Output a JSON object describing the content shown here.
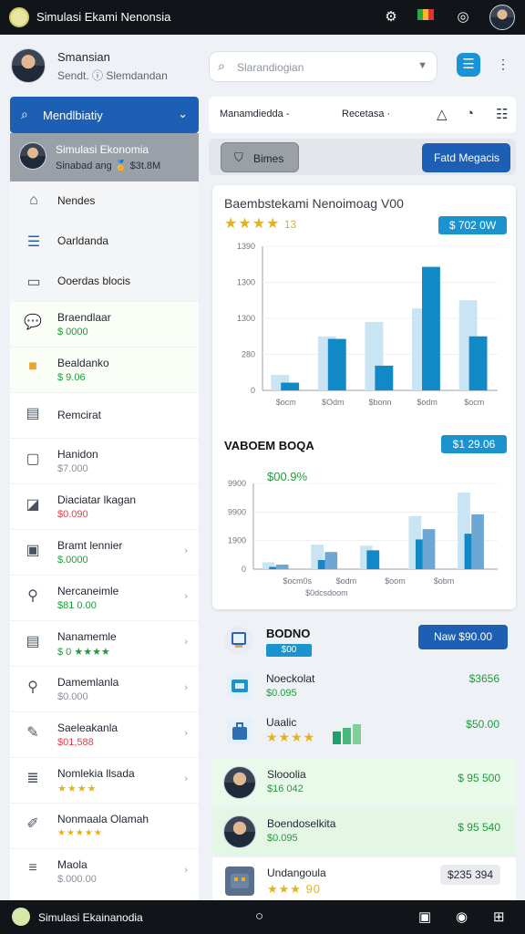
{
  "app": {
    "title": "Simulasi Ekami Nenonsia",
    "icons": [
      "settings-icon",
      "flag-icon",
      "chat-icon"
    ]
  },
  "profile": {
    "name": "Smansian",
    "subtitle": "Sendt. ⓘ Slemdandan"
  },
  "search": {
    "placeholder": "Slarandiogian"
  },
  "sidebar": {
    "header": "Mendlbiatiy",
    "active": {
      "title": "Simulasi Ekonomia",
      "subtitle": "Sinabad ang 🏅 $3t.8M"
    },
    "nav": [
      {
        "label": "Nendes",
        "icon": "home-icon"
      },
      {
        "label": "Oarldanda",
        "icon": "list-icon"
      },
      {
        "label": "Ooerdas blocis",
        "icon": "folder-icon"
      }
    ],
    "rows": [
      {
        "label": "Braendlaar",
        "value": "$ 0000",
        "tone": "green",
        "icon": "chat-bubble-icon"
      },
      {
        "label": "Bealdanko",
        "value": "$ 9.06",
        "tone": "green",
        "icon": "briefcase-icon"
      },
      {
        "label": "Remcirat",
        "value": "",
        "tone": "gray",
        "icon": "box-icon"
      },
      {
        "label": "Hanidon",
        "value": "$7.000",
        "tone": "gray",
        "icon": "document-icon"
      },
      {
        "label": "Diaciatar lkagan",
        "value": "$0.090",
        "tone": "red",
        "icon": "tag-icon"
      },
      {
        "label": "Bramt lennier",
        "value": "$.0000",
        "tone": "green",
        "icon": "clipboard-icon"
      },
      {
        "label": "Nercaneimle",
        "value": "$81 0.00",
        "tone": "green",
        "icon": "wrench-icon"
      },
      {
        "label": "Nanamemle",
        "value": "$ 0 ★★★★",
        "tone": "green",
        "icon": "calendar-icon"
      },
      {
        "label": "Damemlanla",
        "value": "$0.000",
        "tone": "gray",
        "icon": "search-icon"
      },
      {
        "label": "Saeleakanla",
        "value": "$01,588",
        "tone": "red",
        "icon": "pen-icon"
      },
      {
        "label": "Nomlekia llsada",
        "value": "★★★★",
        "tone": "stars",
        "icon": "layers-icon"
      },
      {
        "label": "Nonmaala Olamah",
        "value": "★★★★★",
        "tone": "stars",
        "icon": "pencil-icon"
      },
      {
        "label": "Maola",
        "value": "$.000.00",
        "tone": "gray",
        "icon": "menu-icon"
      }
    ]
  },
  "toolbar": {
    "label1": "Manamdiedda ‑",
    "label2": "Recetasa ·"
  },
  "tabs": {
    "active": "Bimes",
    "button": "Fatd Megacis"
  },
  "chart1": {
    "title": "Baembstekami Nenoimoag V00",
    "stars": "★★★★",
    "star_note": "13",
    "badge": "$ 702 0W"
  },
  "chart2": {
    "title": "VABOEM BOQA",
    "badge": "$1 29.06",
    "percent": "$00.9%"
  },
  "low": {
    "title": "BODNO",
    "badge": "$00",
    "button": "Naw $90.00",
    "rows": [
      {
        "label": "Noeckolat",
        "value": "$0.095",
        "right": "$3656",
        "tone": "green"
      },
      {
        "label": "Uaalic",
        "value": "★★★★",
        "right": "$50.00",
        "tone": "stars"
      }
    ]
  },
  "people": [
    {
      "label": "Slooolia",
      "value": "$16 042",
      "right": "$ 95 500",
      "tone": "green"
    },
    {
      "label": "Boendoselkita",
      "value": "$0.095",
      "right": "$ 95 540",
      "tone": "green"
    },
    {
      "label": "Undangoula",
      "value": "★★★ 90",
      "right": "$235 394",
      "tone": "stars"
    }
  ],
  "navbar": {
    "label": "Simulasi Ekainanodia"
  },
  "chart_data": [
    {
      "type": "bar",
      "title": "Baembstekami Nenoimoag V00",
      "categories": [
        "$ocm",
        "$Odm",
        "$bonn",
        "$odm",
        "$ocm"
      ],
      "series": [
        {
          "name": "",
          "values": [
            300,
            1050,
            1330,
            1590,
            1750
          ],
          "color": "#c9e4f3"
        },
        {
          "name": "",
          "values": [
            150,
            1000,
            480,
            2400,
            1050
          ],
          "color": "#1189c7"
        }
      ],
      "yticks": [
        "0",
        "280",
        "1300",
        "1300",
        "1390"
      ],
      "ylim": [
        0,
        2800
      ]
    },
    {
      "type": "bar",
      "title": "VABOEM BOQA",
      "categories": [
        "$ocm0s",
        "$odm",
        "$oom",
        "$obm"
      ],
      "subtitle": "$0dcsdoom",
      "series": [
        {
          "name": "",
          "values": [
            120,
            430,
            410,
            930,
            1340
          ],
          "color": "#c9e4f3"
        },
        {
          "name": "",
          "values": [
            40,
            160,
            330,
            520,
            620
          ],
          "color": "#1189c7"
        },
        {
          "name": "",
          "values": [
            80,
            300,
            0,
            700,
            960
          ],
          "color": "#6fa7d4"
        }
      ],
      "yticks": [
        "0",
        "1900",
        "9900",
        "9900"
      ],
      "ylim": [
        0,
        1500
      ]
    }
  ]
}
